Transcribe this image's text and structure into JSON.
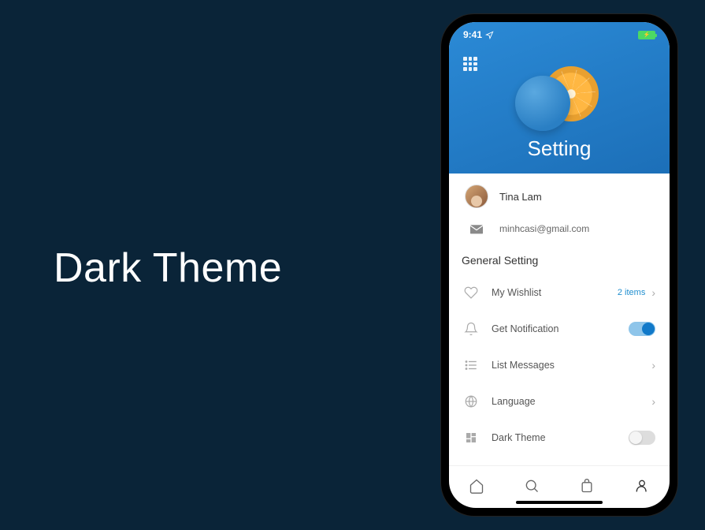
{
  "headline": "Dark Theme",
  "status": {
    "time": "9:41"
  },
  "hero": {
    "title": "Setting"
  },
  "profile": {
    "name": "Tina Lam",
    "email": "minhcasi@gmail.com"
  },
  "section": {
    "title": "General Setting"
  },
  "rows": {
    "wishlist": {
      "label": "My Wishlist",
      "count": "2 items"
    },
    "notification": {
      "label": "Get Notification",
      "on": true
    },
    "messages": {
      "label": "List Messages"
    },
    "language": {
      "label": "Language"
    },
    "darktheme": {
      "label": "Dark Theme",
      "on": false
    }
  }
}
